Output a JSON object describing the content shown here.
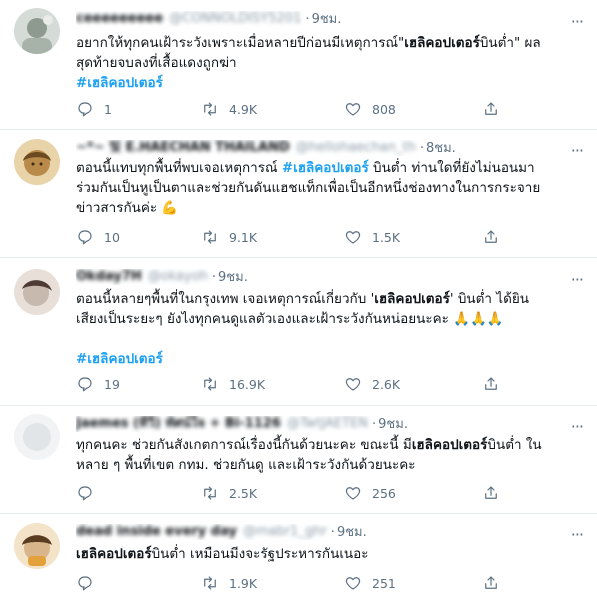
{
  "tweets": [
    {
      "name": "ceeeeeeeee",
      "handle": "@CONNOLDISY5201",
      "time": "9ชม.",
      "lines": [
        [
          {
            "t": "อยากให้ทุกคนเฝ้าระวังเพราะเมื่อหลายปีก่อนมีเหตุการณ์\""
          },
          {
            "t": "เฮลิคอปเตอร์",
            "s": "b"
          },
          {
            "t": "บินต่ำ\" ผล"
          }
        ],
        [
          {
            "t": "สุดท้ายจบลงที่เสื้อแดงถูกฆ่า"
          }
        ],
        [
          {
            "t": "#เฮลิคอปเตอร์",
            "s": "hashtag"
          }
        ]
      ],
      "replies": "1",
      "retweets": "4.9K",
      "likes": "808",
      "avatar_color": "#9aa59c"
    },
    {
      "name": "~*~ 빛 E.HAECHAN THAILAND",
      "handle": "@hellohaechan_th",
      "time": "8ชม.",
      "lines": [
        [
          {
            "t": "ตอนนี้แทบทุกพื้นที่พบเจอเหตุการณ์ "
          },
          {
            "t": "#เฮลิคอปเตอร์",
            "s": "hashtag"
          },
          {
            "t": " บินต่ำ  ท่านใดที่ยังไม่นอนมา"
          }
        ],
        [
          {
            "t": "ร่วมกันเป็นหูเป็นตาและช่วยกันดันแฮชแท็กเพื่อเป็นอีกหนึ่งช่องทางในการกระจาย"
          }
        ],
        [
          {
            "t": "ข่าวสารกันค่ะ 💪"
          }
        ]
      ],
      "replies": "10",
      "retweets": "9.1K",
      "likes": "1.5K",
      "avatar_color": "#b98a4a"
    },
    {
      "name": "Okday7H",
      "handle": "@okayoh",
      "time": "9ชม.",
      "lines": [
        [
          {
            "t": "ตอนนี้หลายๆพื้นที่ในกรุงเทพ เจอเหตุการณ์เกี่ยวกับ '"
          },
          {
            "t": "เฮลิคอปเตอร์",
            "s": "b"
          },
          {
            "t": "' บินต่ำ  ได้ยิน"
          }
        ],
        [
          {
            "t": "เสียงเป็นระยะๆ ยังไงทุกคนดูแลตัวเองและเฝ้าระวังกันหน่อยนะคะ 🙏🙏🙏"
          }
        ],
        [
          {
            "t": ""
          }
        ],
        [
          {
            "t": "#เฮลิคอปเตอร์",
            "s": "hashtag"
          }
        ]
      ],
      "replies": "19",
      "retweets": "16.9K",
      "likes": "2.6K",
      "avatar_color": "#c7b9ae"
    },
    {
      "name": "Jaemes (ทีวี) ทัศน์ใจ + Bi-1126",
      "handle": "@TwtJAETEN",
      "time": "9ชม.",
      "lines": [
        [
          {
            "t": "ทุกคนคะ ช่วยกันสังเกตการณ์เรื่องนี้กันด้วยนะคะ ขณะนี้ มี"
          },
          {
            "t": "เฮลิคอปเตอร์",
            "s": "b"
          },
          {
            "t": "บินต่ำ ใน"
          }
        ],
        [
          {
            "t": "หลาย ๆ พื้นที่เขต กทม. ช่วยกันดู และเฝ้าระวังกันด้วยนะคะ"
          }
        ]
      ],
      "replies": "",
      "retweets": "2.5K",
      "likes": "256",
      "avatar_color": "#e8ecee"
    },
    {
      "name": "dead inside every day",
      "handle": "@mabr1_ghr",
      "time": "9ชม.",
      "lines": [
        [
          {
            "t": "เฮลิคอปเตอร์",
            "s": "b"
          },
          {
            "t": "บินต่ำ เหมือนมีงจะรัฐประหารกันเนอะ"
          }
        ]
      ],
      "replies": "",
      "retweets": "1.9K",
      "likes": "251",
      "avatar_color": "#d8b58a"
    }
  ]
}
